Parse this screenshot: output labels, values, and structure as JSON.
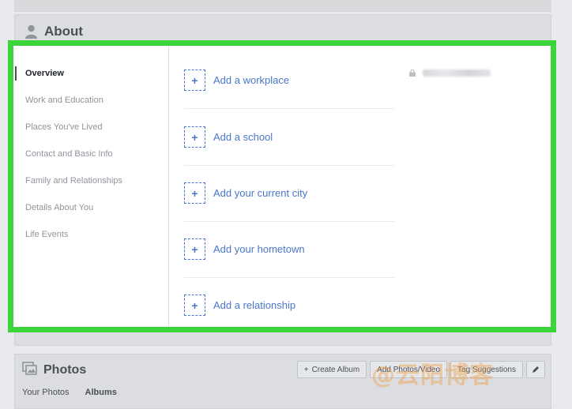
{
  "about": {
    "title": "About",
    "sidebar": [
      {
        "label": "Overview",
        "active": true
      },
      {
        "label": "Work and Education",
        "active": false
      },
      {
        "label": "Places You've Lived",
        "active": false
      },
      {
        "label": "Contact and Basic Info",
        "active": false
      },
      {
        "label": "Family and Relationships",
        "active": false
      },
      {
        "label": "Details About You",
        "active": false
      },
      {
        "label": "Life Events",
        "active": false
      }
    ],
    "add_items": [
      {
        "label": "Add a workplace",
        "icon": "plus-icon"
      },
      {
        "label": "Add a school",
        "icon": "plus-icon"
      },
      {
        "label": "Add your current city",
        "icon": "plus-icon"
      },
      {
        "label": "Add your hometown",
        "icon": "plus-icon"
      },
      {
        "label": "Add a relationship",
        "icon": "plus-icon"
      }
    ],
    "highlight_color": "#3bd43b",
    "link_color": "#4a76c9"
  },
  "photos": {
    "title": "Photos",
    "tabs": [
      "Your Photos",
      "Albums"
    ],
    "toolbar": {
      "create_album": "Create Album",
      "add_photos": "Add Photos/Video",
      "tag_suggestions": "Tag Suggestions"
    }
  },
  "watermark": "@云阳博客"
}
